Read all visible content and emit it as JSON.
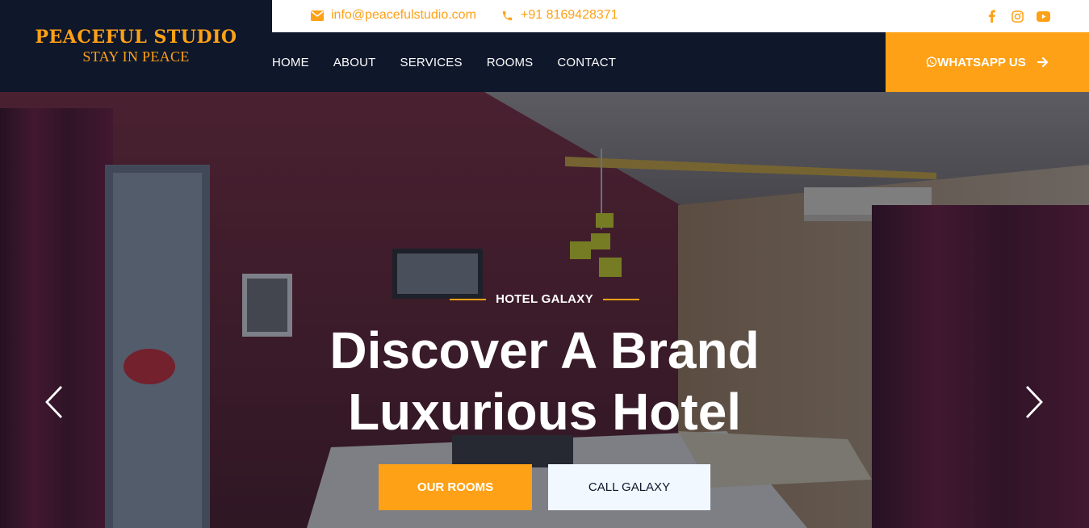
{
  "brand": {
    "name": "PEACEFUL STUDIO",
    "tagline": "STAY IN PEACE"
  },
  "topbar": {
    "email": "info@peacefulstudio.com",
    "phone": "+91 8169428371",
    "socials": [
      "facebook-icon",
      "instagram-icon",
      "youtube-icon"
    ]
  },
  "nav": {
    "items": [
      "HOME",
      "ABOUT",
      "SERVICES",
      "ROOMS",
      "CONTACT"
    ]
  },
  "cta": {
    "whatsapp": "WHATSAPP US"
  },
  "hero": {
    "eyebrow": "HOTEL GALAXY",
    "headline_line1": "Discover A Brand",
    "headline_line2": "Luxurious Hotel",
    "btn_rooms": "OUR ROOMS",
    "btn_call": "CALL GALAXY"
  },
  "colors": {
    "accent": "#fea116",
    "dark": "#0f172b",
    "light_button": "#f1f8ff"
  }
}
